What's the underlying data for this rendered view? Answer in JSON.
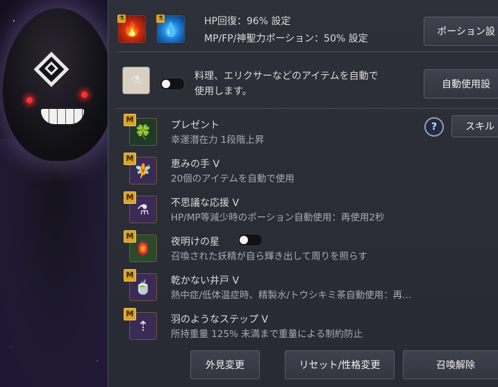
{
  "potion": {
    "hp_line": "HP回復：96% 設定",
    "mp_line": "MP/FP/神聖力ポーション：50% 設定",
    "settings_button": "ポーション設"
  },
  "auto_use": {
    "line1": "料理、エリクサーなどのアイテムを自動で",
    "line2": "使用します。",
    "button": "自動使用設",
    "enabled": false
  },
  "skills_button": "スキル",
  "help_label": "?",
  "skills": [
    {
      "badge": "M",
      "name": "プレゼント",
      "desc": "幸運潜在力 1段階上昇",
      "icon": "clover-icon",
      "color": "#1f3a2a"
    },
    {
      "badge": "M",
      "name": "恵みの手 V",
      "desc": "20個のアイテムを自動で使用",
      "icon": "fairy-icon",
      "color": "#3a2a55"
    },
    {
      "badge": "M",
      "name": "不思議な応援 V",
      "desc": "HP/MP等減少時のポーション自動使用：再使用2秒",
      "icon": "potion-flask-icon",
      "color": "#3a2a55"
    },
    {
      "badge": "M",
      "name": "夜明けの星",
      "desc": "召喚された妖精が自ら輝き出して周りを照らす",
      "icon": "lantern-icon",
      "color": "#2a4a2a",
      "has_toggle": true
    },
    {
      "badge": "M",
      "name": "乾かない井戸 V",
      "desc": "熱中症/低体温症時、精製水/トウシキミ茶自動使用：再...",
      "icon": "bowl-icon",
      "color": "#3a2a55"
    },
    {
      "badge": "M",
      "name": "羽のようなステップ V",
      "desc": "所持重量 125% 未満まで重量による制約防止",
      "icon": "weight-icon",
      "color": "#3a2a55"
    }
  ],
  "footer": {
    "appearance": "外見変更",
    "reset": "リセット/性格変更",
    "dismiss": "召喚解除"
  }
}
